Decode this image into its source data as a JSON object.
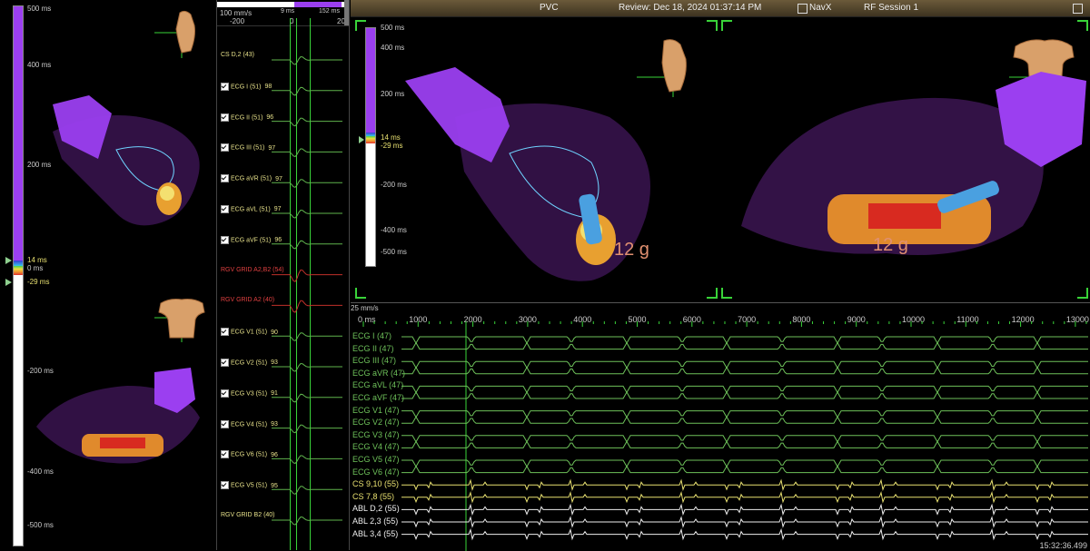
{
  "topbar": {
    "left_indicator": "PVC",
    "review": "Review: Dec 18, 2024 01:37:14 PM",
    "system": "NavX",
    "session": "RF Session 1"
  },
  "left_scale": {
    "top": "500 ms",
    "t400": "400 ms",
    "t200": "200 ms",
    "t14": "14 ms",
    "t0": "0 ms",
    "tm29": "-29 ms",
    "tm200": "-200 ms",
    "tm400": "-400 ms",
    "bottom": "-500 ms"
  },
  "mid": {
    "speed": "100 mm/s",
    "time_scale": [
      "-200",
      "0",
      "20"
    ],
    "window_vals": [
      "9 ms",
      "152 ms"
    ],
    "channels": [
      {
        "label": "CS D,2 (43)",
        "checked": false,
        "red": false
      },
      {
        "label": "ECG I (51)",
        "value": "98",
        "checked": true,
        "red": false
      },
      {
        "label": "ECG II (51)",
        "value": "96",
        "checked": true,
        "red": false
      },
      {
        "label": "ECG III (51)",
        "value": "97",
        "checked": true,
        "red": false
      },
      {
        "label": "ECG aVR (51)",
        "value": "97",
        "checked": true,
        "red": false
      },
      {
        "label": "ECG aVL (51)",
        "value": "97",
        "checked": true,
        "red": false
      },
      {
        "label": "ECG aVF (51)",
        "value": "96",
        "checked": true,
        "red": false
      },
      {
        "label": "RGV GRID A2,B2 (54)",
        "checked": false,
        "red": true
      },
      {
        "label": "RGV GRID A2 (40)",
        "checked": false,
        "red": true
      },
      {
        "label": "ECG V1 (51)",
        "value": "90",
        "checked": true,
        "red": false
      },
      {
        "label": "ECG V2 (51)",
        "value": "93",
        "checked": true,
        "red": false
      },
      {
        "label": "ECG V3 (51)",
        "value": "91",
        "checked": true,
        "red": false
      },
      {
        "label": "ECG V4 (51)",
        "value": "93",
        "checked": true,
        "red": false
      },
      {
        "label": "ECG V6 (51)",
        "value": "96",
        "checked": true,
        "red": false
      },
      {
        "label": "ECG V5 (51)",
        "value": "95",
        "checked": true,
        "red": false
      },
      {
        "label": "RGV GRID B2 (40)",
        "checked": false,
        "red": false
      }
    ]
  },
  "right_scale": {
    "top": "500 ms",
    "t400": "400 ms",
    "t200": "200 ms",
    "t14": "14 ms",
    "tm29": "-29 ms",
    "tm200": "-200 ms",
    "tm400": "-400 ms",
    "bottom": "-500 ms"
  },
  "force_labels": [
    "12 g",
    "12 g"
  ],
  "timeline": {
    "speed": "25 mm/s",
    "ticks": [
      "0 ms",
      "1000",
      "2000",
      "3000",
      "4000",
      "5000",
      "6000",
      "7000",
      "8000",
      "9000",
      "10000",
      "11000",
      "12000",
      "13000"
    ],
    "traces": [
      {
        "label": "ECG I (47)",
        "kind": "ecg"
      },
      {
        "label": "ECG II (47)",
        "kind": "ecg"
      },
      {
        "label": "ECG III (47)",
        "kind": "ecg"
      },
      {
        "label": "ECG aVR (47)",
        "kind": "ecg"
      },
      {
        "label": "ECG aVL (47)",
        "kind": "ecg"
      },
      {
        "label": "ECG aVF (47)",
        "kind": "ecg"
      },
      {
        "label": "ECG V1 (47)",
        "kind": "ecg"
      },
      {
        "label": "ECG V2 (47)",
        "kind": "ecg"
      },
      {
        "label": "ECG V3 (47)",
        "kind": "ecg"
      },
      {
        "label": "ECG V4 (47)",
        "kind": "ecg"
      },
      {
        "label": "ECG V5 (47)",
        "kind": "ecg"
      },
      {
        "label": "ECG V6 (47)",
        "kind": "ecg"
      },
      {
        "label": "CS 9,10 (55)",
        "kind": "cs"
      },
      {
        "label": "CS 7,8 (55)",
        "kind": "cs"
      },
      {
        "label": "ABL D,2 (55)",
        "kind": "abl"
      },
      {
        "label": "ABL 2,3 (55)",
        "kind": "abl"
      },
      {
        "label": "ABL 3,4 (55)",
        "kind": "abl"
      }
    ],
    "clock": "15:32:36.499"
  },
  "colors": {
    "ecg": "#6ec15a",
    "cs": "#e8e070",
    "abl": "#eeeeee",
    "scale_purple": "#9b3ff0",
    "cursor": "#39d339"
  }
}
